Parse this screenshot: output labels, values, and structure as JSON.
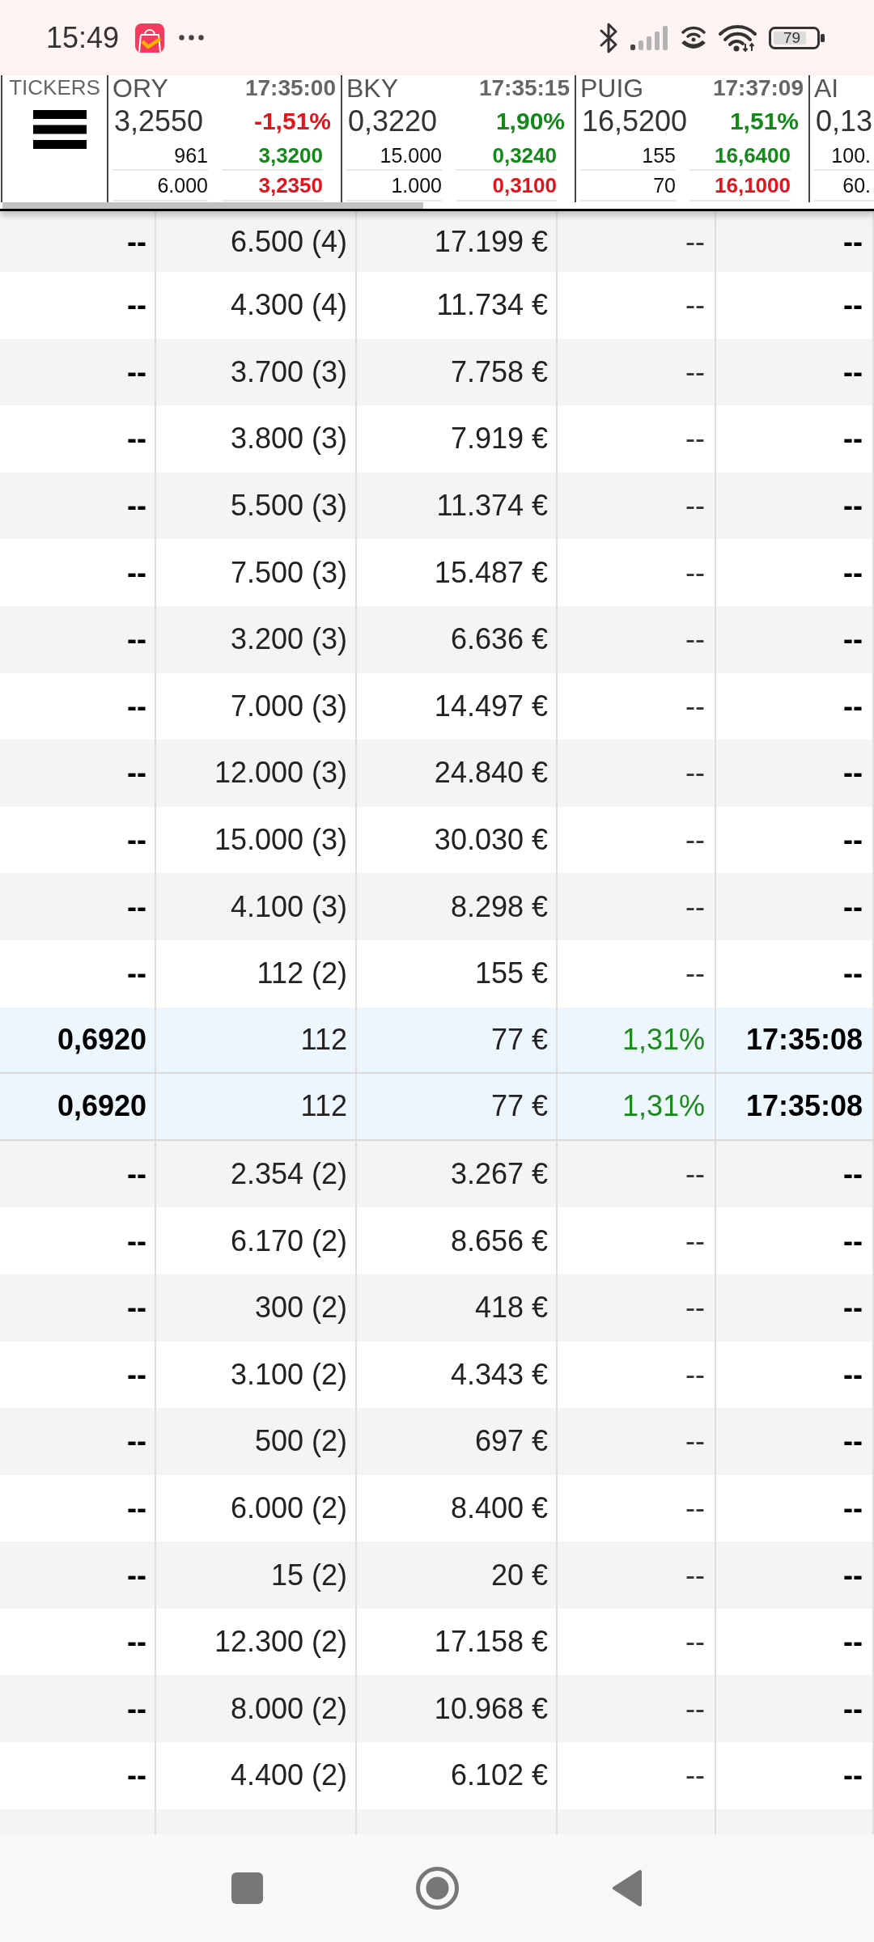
{
  "status_bar": {
    "time": "15:49",
    "battery": "79"
  },
  "ticker_bar": {
    "label": "TICKERS",
    "tickers": [
      {
        "symbol": "ORY",
        "time": "17:35:00",
        "price": "3,2550",
        "change": "-1,51%",
        "positive": false,
        "size_1": "961",
        "price_1": "3,3200",
        "size_2": "6.000",
        "price_2": "3,2350"
      },
      {
        "symbol": "BKY",
        "time": "17:35:15",
        "price": "0,3220",
        "change": "1,90%",
        "positive": true,
        "size_1": "15.000",
        "price_1": "0,3240",
        "size_2": "1.000",
        "price_2": "0,3100"
      },
      {
        "symbol": "PUIG",
        "time": "17:37:09",
        "price": "16,5200",
        "change": "1,51%",
        "positive": true,
        "size_1": "155",
        "price_1": "16,6400",
        "size_2": "70",
        "price_2": "16,1000"
      },
      {
        "symbol": "AI",
        "price": "0,13",
        "size_1": "100.",
        "size_2": "60."
      }
    ]
  },
  "table": {
    "rows": [
      {
        "highlighted": false,
        "cells": [
          "--",
          "6.500 (4)",
          "17.199 €",
          "--",
          "--"
        ]
      },
      {
        "highlighted": false,
        "cells": [
          "--",
          "4.300 (4)",
          "11.734 €",
          "--",
          "--"
        ]
      },
      {
        "highlighted": false,
        "cells": [
          "--",
          "3.700 (3)",
          "7.758 €",
          "--",
          "--"
        ]
      },
      {
        "highlighted": false,
        "cells": [
          "--",
          "3.800 (3)",
          "7.919 €",
          "--",
          "--"
        ]
      },
      {
        "highlighted": false,
        "cells": [
          "--",
          "5.500 (3)",
          "11.374 €",
          "--",
          "--"
        ]
      },
      {
        "highlighted": false,
        "cells": [
          "--",
          "7.500 (3)",
          "15.487 €",
          "--",
          "--"
        ]
      },
      {
        "highlighted": false,
        "cells": [
          "--",
          "3.200 (3)",
          "6.636 €",
          "--",
          "--"
        ]
      },
      {
        "highlighted": false,
        "cells": [
          "--",
          "7.000 (3)",
          "14.497 €",
          "--",
          "--"
        ]
      },
      {
        "highlighted": false,
        "cells": [
          "--",
          "12.000 (3)",
          "24.840 €",
          "--",
          "--"
        ]
      },
      {
        "highlighted": false,
        "cells": [
          "--",
          "15.000 (3)",
          "30.030 €",
          "--",
          "--"
        ]
      },
      {
        "highlighted": false,
        "cells": [
          "--",
          "4.100 (3)",
          "8.298 €",
          "--",
          "--"
        ]
      },
      {
        "highlighted": false,
        "cells": [
          "--",
          "112 (2)",
          "155 €",
          "--",
          "--"
        ]
      },
      {
        "highlighted": true,
        "cells": [
          "0,6920",
          "112",
          "77 €",
          "1,31%",
          "17:35:08"
        ]
      },
      {
        "highlighted": true,
        "cells": [
          "0,6920",
          "112",
          "77 €",
          "1,31%",
          "17:35:08"
        ]
      },
      {
        "highlighted": false,
        "cells": [
          "--",
          "2.354 (2)",
          "3.267 €",
          "--",
          "--"
        ]
      },
      {
        "highlighted": false,
        "cells": [
          "--",
          "6.170 (2)",
          "8.656 €",
          "--",
          "--"
        ]
      },
      {
        "highlighted": false,
        "cells": [
          "--",
          "300 (2)",
          "418 €",
          "--",
          "--"
        ]
      },
      {
        "highlighted": false,
        "cells": [
          "--",
          "3.100 (2)",
          "4.343 €",
          "--",
          "--"
        ]
      },
      {
        "highlighted": false,
        "cells": [
          "--",
          "500 (2)",
          "697 €",
          "--",
          "--"
        ]
      },
      {
        "highlighted": false,
        "cells": [
          "--",
          "6.000 (2)",
          "8.400 €",
          "--",
          "--"
        ]
      },
      {
        "highlighted": false,
        "cells": [
          "--",
          "15 (2)",
          "20 €",
          "--",
          "--"
        ]
      },
      {
        "highlighted": false,
        "cells": [
          "--",
          "12.300 (2)",
          "17.158 €",
          "--",
          "--"
        ]
      },
      {
        "highlighted": false,
        "cells": [
          "--",
          "8.000 (2)",
          "10.968 €",
          "--",
          "--"
        ]
      },
      {
        "highlighted": false,
        "cells": [
          "--",
          "4.400 (2)",
          "6.102 €",
          "--",
          "--"
        ]
      }
    ]
  }
}
